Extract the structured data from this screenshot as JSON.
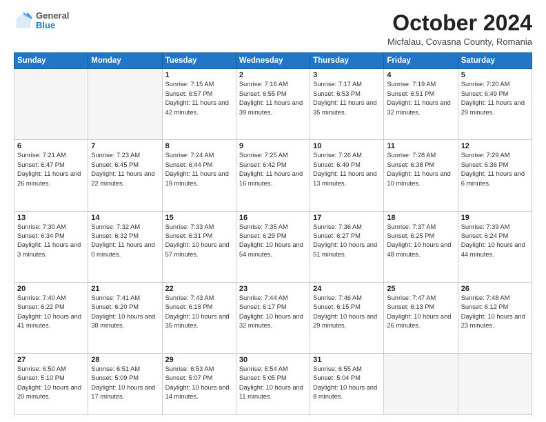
{
  "logo": {
    "general": "General",
    "blue": "Blue"
  },
  "header": {
    "month": "October 2024",
    "location": "Micfalau, Covasna County, Romania"
  },
  "weekdays": [
    "Sunday",
    "Monday",
    "Tuesday",
    "Wednesday",
    "Thursday",
    "Friday",
    "Saturday"
  ],
  "weeks": [
    [
      {
        "day": "",
        "info": ""
      },
      {
        "day": "",
        "info": ""
      },
      {
        "day": "1",
        "info": "Sunrise: 7:15 AM\nSunset: 6:57 PM\nDaylight: 11 hours and 42 minutes."
      },
      {
        "day": "2",
        "info": "Sunrise: 7:16 AM\nSunset: 6:55 PM\nDaylight: 11 hours and 39 minutes."
      },
      {
        "day": "3",
        "info": "Sunrise: 7:17 AM\nSunset: 6:53 PM\nDaylight: 11 hours and 35 minutes."
      },
      {
        "day": "4",
        "info": "Sunrise: 7:19 AM\nSunset: 6:51 PM\nDaylight: 11 hours and 32 minutes."
      },
      {
        "day": "5",
        "info": "Sunrise: 7:20 AM\nSunset: 6:49 PM\nDaylight: 11 hours and 29 minutes."
      }
    ],
    [
      {
        "day": "6",
        "info": "Sunrise: 7:21 AM\nSunset: 6:47 PM\nDaylight: 11 hours and 26 minutes."
      },
      {
        "day": "7",
        "info": "Sunrise: 7:23 AM\nSunset: 6:45 PM\nDaylight: 11 hours and 22 minutes."
      },
      {
        "day": "8",
        "info": "Sunrise: 7:24 AM\nSunset: 6:44 PM\nDaylight: 11 hours and 19 minutes."
      },
      {
        "day": "9",
        "info": "Sunrise: 7:25 AM\nSunset: 6:42 PM\nDaylight: 11 hours and 16 minutes."
      },
      {
        "day": "10",
        "info": "Sunrise: 7:26 AM\nSunset: 6:40 PM\nDaylight: 11 hours and 13 minutes."
      },
      {
        "day": "11",
        "info": "Sunrise: 7:28 AM\nSunset: 6:38 PM\nDaylight: 11 hours and 10 minutes."
      },
      {
        "day": "12",
        "info": "Sunrise: 7:29 AM\nSunset: 6:36 PM\nDaylight: 11 hours and 6 minutes."
      }
    ],
    [
      {
        "day": "13",
        "info": "Sunrise: 7:30 AM\nSunset: 6:34 PM\nDaylight: 11 hours and 3 minutes."
      },
      {
        "day": "14",
        "info": "Sunrise: 7:32 AM\nSunset: 6:32 PM\nDaylight: 11 hours and 0 minutes."
      },
      {
        "day": "15",
        "info": "Sunrise: 7:33 AM\nSunset: 6:31 PM\nDaylight: 10 hours and 57 minutes."
      },
      {
        "day": "16",
        "info": "Sunrise: 7:35 AM\nSunset: 6:29 PM\nDaylight: 10 hours and 54 minutes."
      },
      {
        "day": "17",
        "info": "Sunrise: 7:36 AM\nSunset: 6:27 PM\nDaylight: 10 hours and 51 minutes."
      },
      {
        "day": "18",
        "info": "Sunrise: 7:37 AM\nSunset: 6:25 PM\nDaylight: 10 hours and 48 minutes."
      },
      {
        "day": "19",
        "info": "Sunrise: 7:39 AM\nSunset: 6:24 PM\nDaylight: 10 hours and 44 minutes."
      }
    ],
    [
      {
        "day": "20",
        "info": "Sunrise: 7:40 AM\nSunset: 6:22 PM\nDaylight: 10 hours and 41 minutes."
      },
      {
        "day": "21",
        "info": "Sunrise: 7:41 AM\nSunset: 6:20 PM\nDaylight: 10 hours and 38 minutes."
      },
      {
        "day": "22",
        "info": "Sunrise: 7:43 AM\nSunset: 6:18 PM\nDaylight: 10 hours and 35 minutes."
      },
      {
        "day": "23",
        "info": "Sunrise: 7:44 AM\nSunset: 6:17 PM\nDaylight: 10 hours and 32 minutes."
      },
      {
        "day": "24",
        "info": "Sunrise: 7:46 AM\nSunset: 6:15 PM\nDaylight: 10 hours and 29 minutes."
      },
      {
        "day": "25",
        "info": "Sunrise: 7:47 AM\nSunset: 6:13 PM\nDaylight: 10 hours and 26 minutes."
      },
      {
        "day": "26",
        "info": "Sunrise: 7:48 AM\nSunset: 6:12 PM\nDaylight: 10 hours and 23 minutes."
      }
    ],
    [
      {
        "day": "27",
        "info": "Sunrise: 6:50 AM\nSunset: 5:10 PM\nDaylight: 10 hours and 20 minutes."
      },
      {
        "day": "28",
        "info": "Sunrise: 6:51 AM\nSunset: 5:09 PM\nDaylight: 10 hours and 17 minutes."
      },
      {
        "day": "29",
        "info": "Sunrise: 6:53 AM\nSunset: 5:07 PM\nDaylight: 10 hours and 14 minutes."
      },
      {
        "day": "30",
        "info": "Sunrise: 6:54 AM\nSunset: 5:05 PM\nDaylight: 10 hours and 11 minutes."
      },
      {
        "day": "31",
        "info": "Sunrise: 6:55 AM\nSunset: 5:04 PM\nDaylight: 10 hours and 8 minutes."
      },
      {
        "day": "",
        "info": ""
      },
      {
        "day": "",
        "info": ""
      }
    ]
  ]
}
